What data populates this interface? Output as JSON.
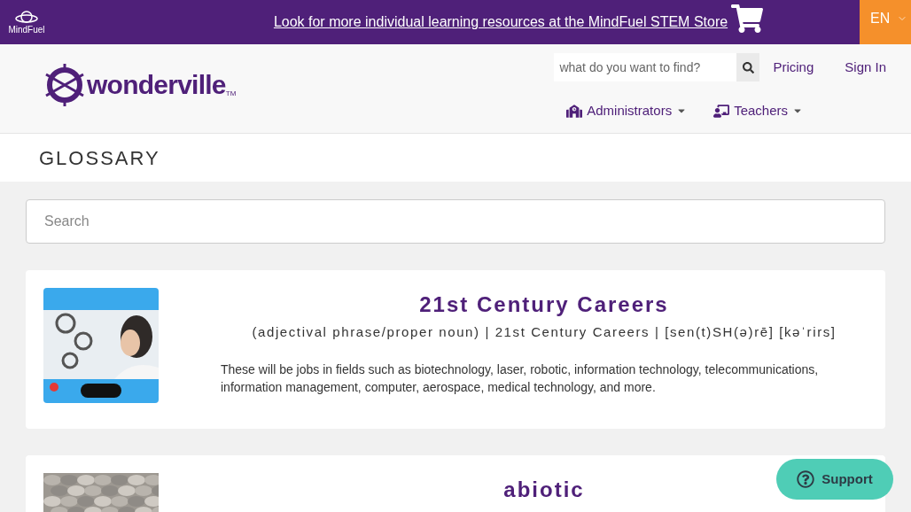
{
  "banner": {
    "brand": "MindFuel",
    "message": "Look for more individual learning resources at the MindFuel STEM Store",
    "language": "EN"
  },
  "header": {
    "logo": "wonderville",
    "logo_mark": "TM",
    "search": {
      "placeholder": "what do you want to find?"
    },
    "links": [
      "Pricing",
      "Sign In"
    ],
    "menus": [
      {
        "label": "Administrators",
        "kind": "building"
      },
      {
        "label": "Teachers",
        "kind": "teacher"
      }
    ]
  },
  "page_title": "GLOSSARY",
  "search": {
    "placeholder": "Search"
  },
  "entries": [
    {
      "term": "21st Century Careers",
      "pronunciation": "(adjectival phrase/proper noun) | 21st Century Careers | [sen(t)SH(ə)rē] [kəˈrirs]",
      "definition": "These will be jobs in fields such as biotechnology, laser, robotic, information technology, telecommunications, information management, computer, aerospace, medical technology, and more.",
      "kind": "picture"
    },
    {
      "term": "abiotic",
      "kind": "picture"
    }
  ],
  "support": {
    "label": "Support"
  }
}
